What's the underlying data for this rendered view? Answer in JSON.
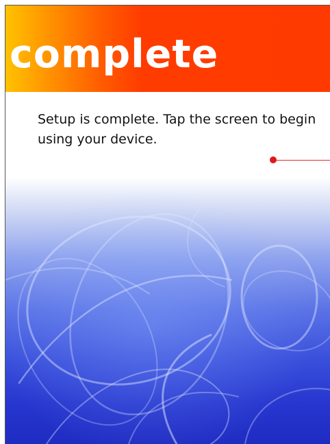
{
  "header": {
    "title": "complete"
  },
  "message": {
    "text": "Setup is complete. Tap the screen to begin using your device."
  },
  "colors": {
    "header_start": "#ffc200",
    "header_end": "#ff3a00",
    "pointer": "#e01818",
    "art_bottom": "#1f2cc2"
  }
}
